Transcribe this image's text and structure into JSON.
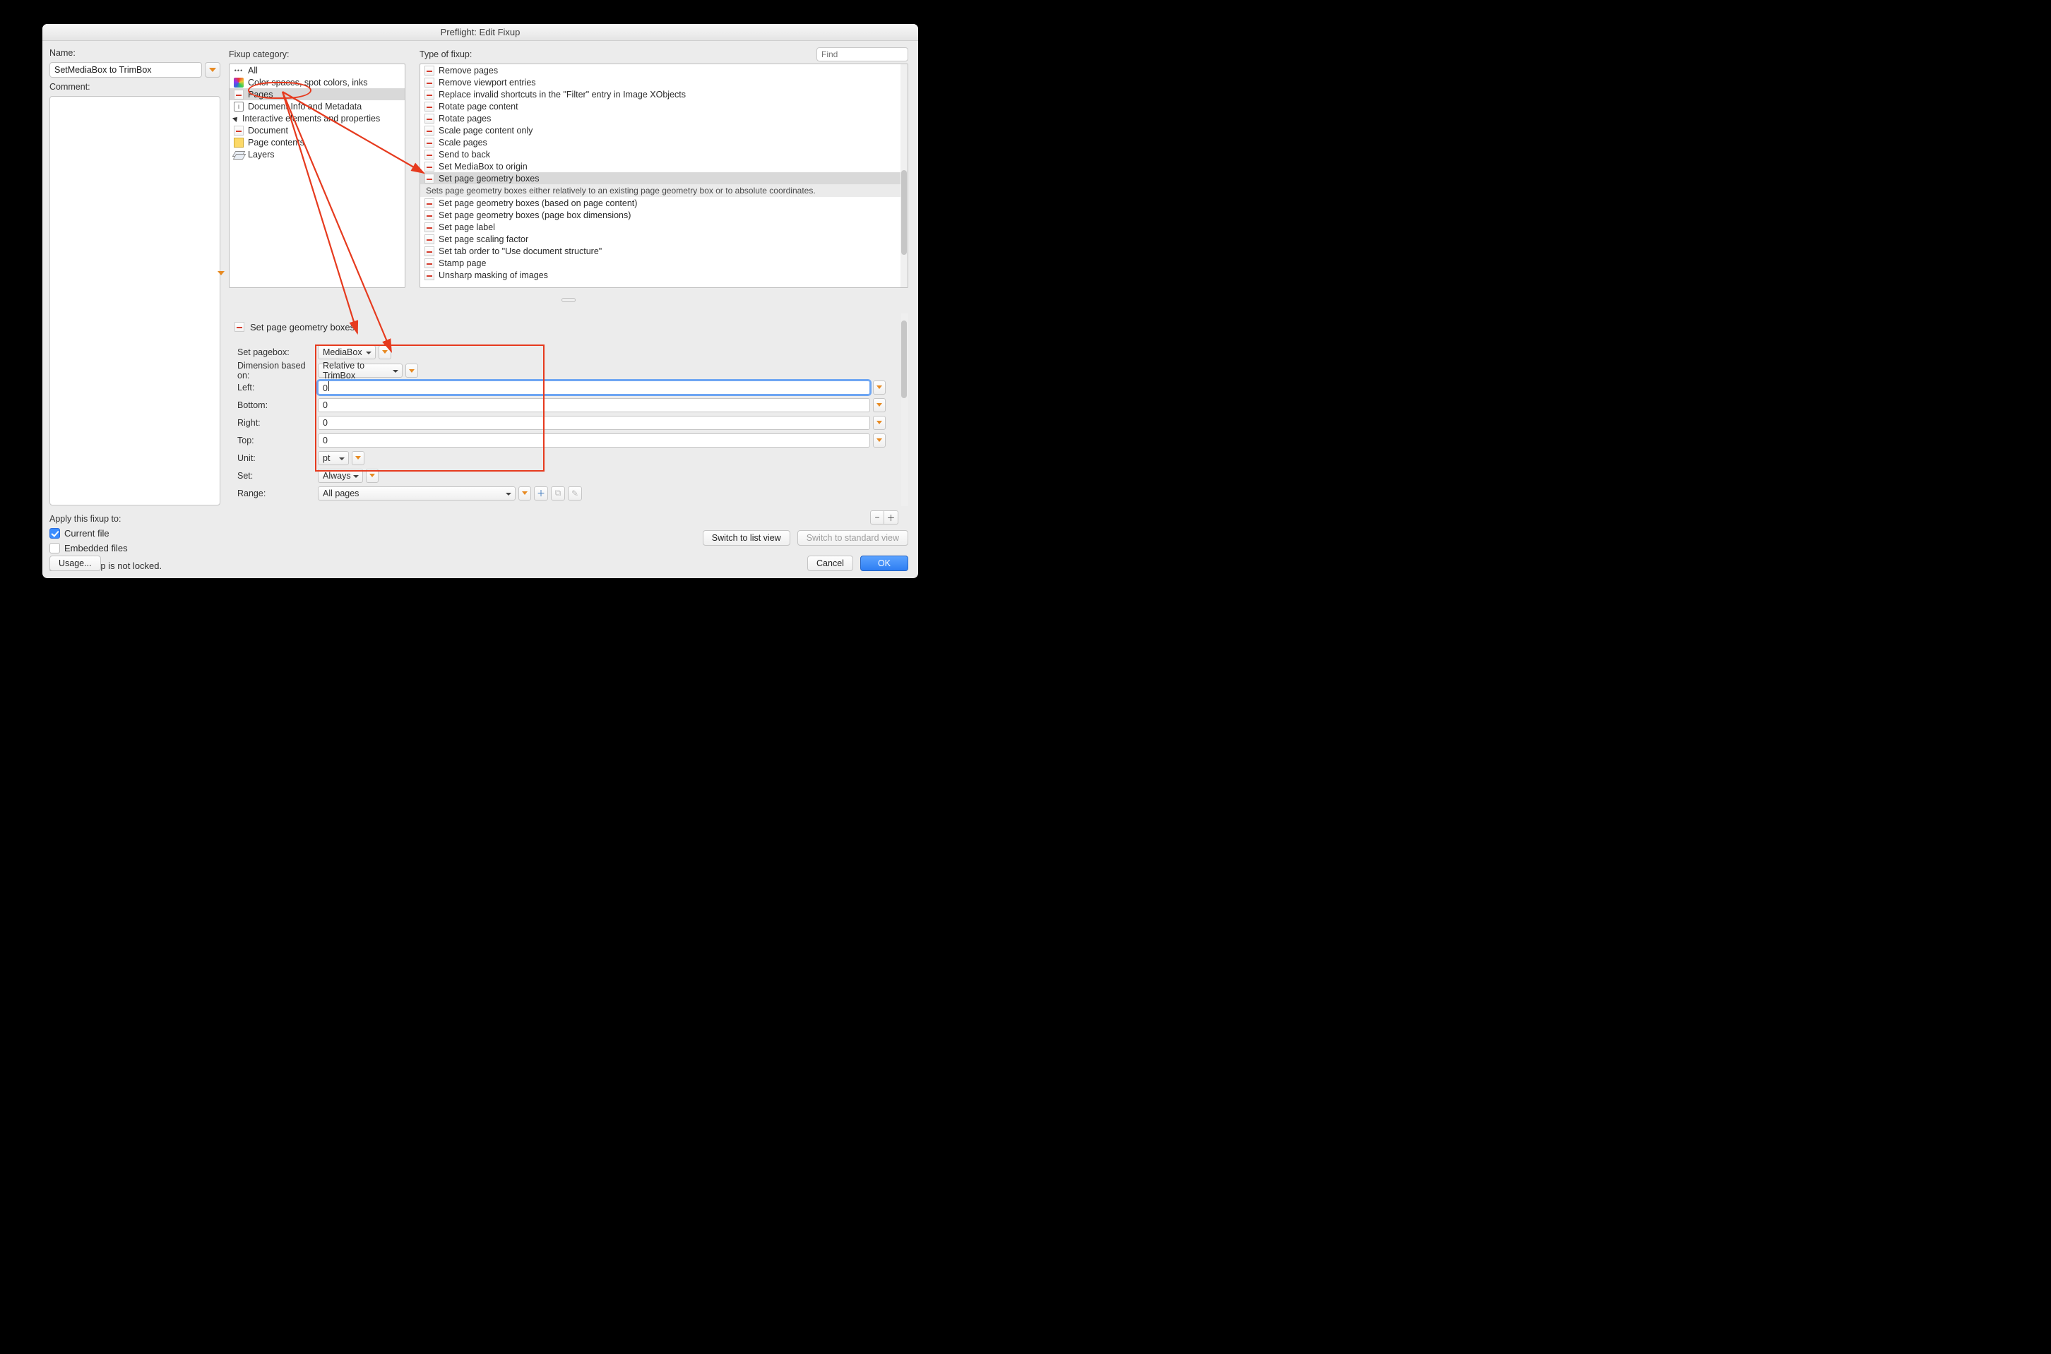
{
  "window": {
    "title": "Preflight: Edit Fixup"
  },
  "left": {
    "name_label": "Name:",
    "name_value": "SetMediaBox to TrimBox",
    "comment_label": "Comment:",
    "apply_label": "Apply this fixup to:",
    "current_file": "Current file",
    "embedded_files": "Embedded files",
    "lock_text": "This fixup is not locked.",
    "usage_btn": "Usage..."
  },
  "categories": {
    "header": "Fixup category:",
    "items": [
      {
        "icon": "dots",
        "label": "All"
      },
      {
        "icon": "color",
        "label": "Color spaces, spot colors, inks"
      },
      {
        "icon": "pdf",
        "label": "Pages",
        "selected": true
      },
      {
        "icon": "info",
        "label": "Document Info and Metadata"
      },
      {
        "icon": "cursor",
        "label": "Interactive elements and properties"
      },
      {
        "icon": "pdf",
        "label": "Document"
      },
      {
        "icon": "doc",
        "label": "Page contents"
      },
      {
        "icon": "layers",
        "label": "Layers"
      }
    ]
  },
  "fixups": {
    "header": "Type of fixup:",
    "search_placeholder": "Find",
    "items": [
      {
        "label": "Remove pages"
      },
      {
        "label": "Remove viewport entries"
      },
      {
        "label": "Replace invalid shortcuts in the \"Filter\" entry in Image XObjects"
      },
      {
        "label": "Rotate page content"
      },
      {
        "label": "Rotate pages"
      },
      {
        "label": "Scale page content only"
      },
      {
        "label": "Scale pages"
      },
      {
        "label": "Send to back"
      },
      {
        "label": "Set MediaBox to origin"
      },
      {
        "label": "Set page geometry boxes",
        "selected": true,
        "description": "Sets page geometry boxes either relatively to an existing page geometry box or to absolute coordinates."
      },
      {
        "label": "Set page geometry boxes (based on page content)"
      },
      {
        "label": "Set page geometry boxes (page box dimensions)"
      },
      {
        "label": "Set page label"
      },
      {
        "label": "Set page scaling factor"
      },
      {
        "label": "Set tab order to \"Use document structure\""
      },
      {
        "label": "Stamp page"
      },
      {
        "label": "Unsharp masking of images"
      }
    ]
  },
  "form": {
    "title": "Set page geometry boxes:",
    "rows": {
      "set_pagebox": {
        "label": "Set pagebox:",
        "value": "MediaBox"
      },
      "dimension": {
        "label": "Dimension based on:",
        "value": "Relative to TrimBox"
      },
      "left": {
        "label": "Left:",
        "value": "0",
        "focused": true
      },
      "bottom": {
        "label": "Bottom:",
        "value": "0"
      },
      "right": {
        "label": "Right:",
        "value": "0"
      },
      "top": {
        "label": "Top:",
        "value": "0"
      },
      "unit": {
        "label": "Unit:",
        "value": "pt"
      },
      "set": {
        "label": "Set:",
        "value": "Always"
      },
      "range": {
        "label": "Range:",
        "value": "All pages"
      }
    }
  },
  "buttons": {
    "switch_list": "Switch to list view",
    "switch_std": "Switch to standard view",
    "cancel": "Cancel",
    "ok": "OK"
  }
}
